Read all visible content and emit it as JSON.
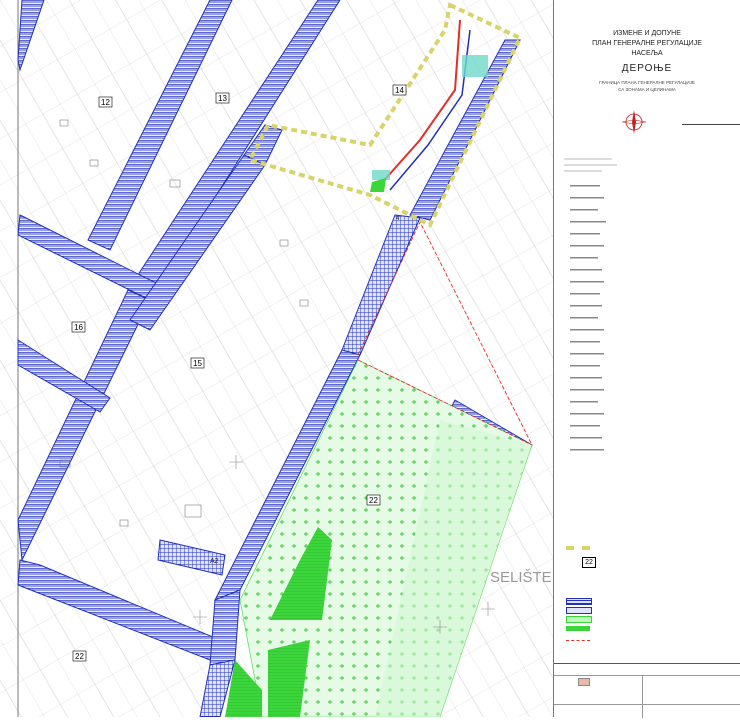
{
  "map": {
    "zone_labels": [
      "12",
      "13",
      "14",
      "15",
      "16",
      "22",
      "22"
    ],
    "place_name": "SELIŠTE",
    "road_label": "A2",
    "small_mark": "4",
    "colors": {
      "road_hatch": "#2230b8",
      "green_zone": "#3ad63a",
      "green_light": "#bff5bf",
      "boundary_yellow": "#d9d36a",
      "boundary_red": "#e0302a"
    }
  },
  "legend": {
    "title_lines": [
      "ИЗМЕНЕ И ДОПУНЕ",
      "ПЛАН ГЕНЕРАЛНЕ РЕГУЛАЦИЈЕ",
      "НАСЕЉА"
    ],
    "place": "ДЕРОЊЕ",
    "subtitle_lines": [
      "ГРАНИЦА ПЛАНА ГЕНЕРАЛНЕ РЕГУЛАЦИЈЕ",
      "СА ЗОНАМА И ЦЕЛИНАМА"
    ],
    "box_label": "22",
    "rows": [
      "",
      "",
      "",
      "",
      "",
      "",
      "",
      ""
    ]
  },
  "title_block": {
    "row1": "",
    "row2": "",
    "row3": "",
    "row4": ""
  }
}
